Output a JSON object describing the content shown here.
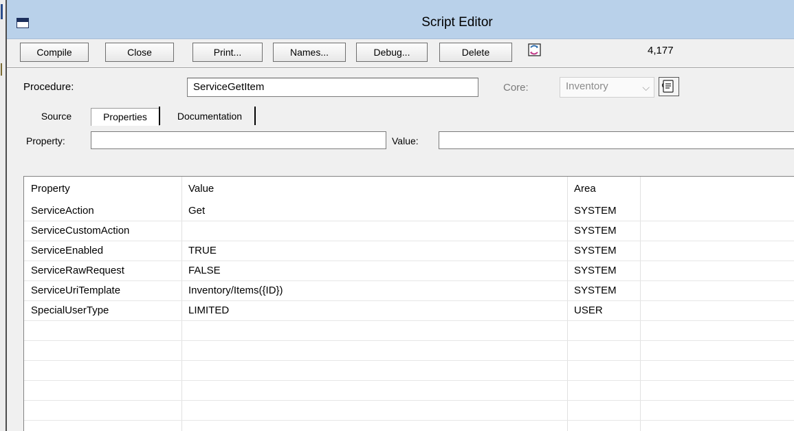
{
  "window": {
    "title": "Script Editor"
  },
  "toolbar": {
    "compile": "Compile",
    "close": "Close",
    "print": "Print...",
    "names": "Names...",
    "debug": "Debug...",
    "delete": "Delete",
    "counter": "4,177"
  },
  "procedure": {
    "label": "Procedure:",
    "value": "ServiceGetItem",
    "core_label": "Core:",
    "core_value": "Inventory"
  },
  "tabs": [
    {
      "label": "Source"
    },
    {
      "label": "Properties"
    },
    {
      "label": "Documentation"
    }
  ],
  "property_editor": {
    "property_label": "Property:",
    "value_label": "Value:"
  },
  "grid": {
    "columns": [
      "Property",
      "Value",
      "Area"
    ],
    "rows": [
      {
        "property": "ServiceAction",
        "value": "Get",
        "area": "SYSTEM"
      },
      {
        "property": "ServiceCustomAction",
        "value": "",
        "area": "SYSTEM"
      },
      {
        "property": "ServiceEnabled",
        "value": "TRUE",
        "area": "SYSTEM"
      },
      {
        "property": "ServiceRawRequest",
        "value": "FALSE",
        "area": "SYSTEM"
      },
      {
        "property": "ServiceUriTemplate",
        "value": "Inventory/Items({ID})",
        "area": "SYSTEM"
      },
      {
        "property": "SpecialUserType",
        "value": "LIMITED",
        "area": "USER"
      }
    ]
  },
  "colors": {
    "titlebar": "#b9d1ea",
    "window_bg": "#f0f0f0"
  }
}
